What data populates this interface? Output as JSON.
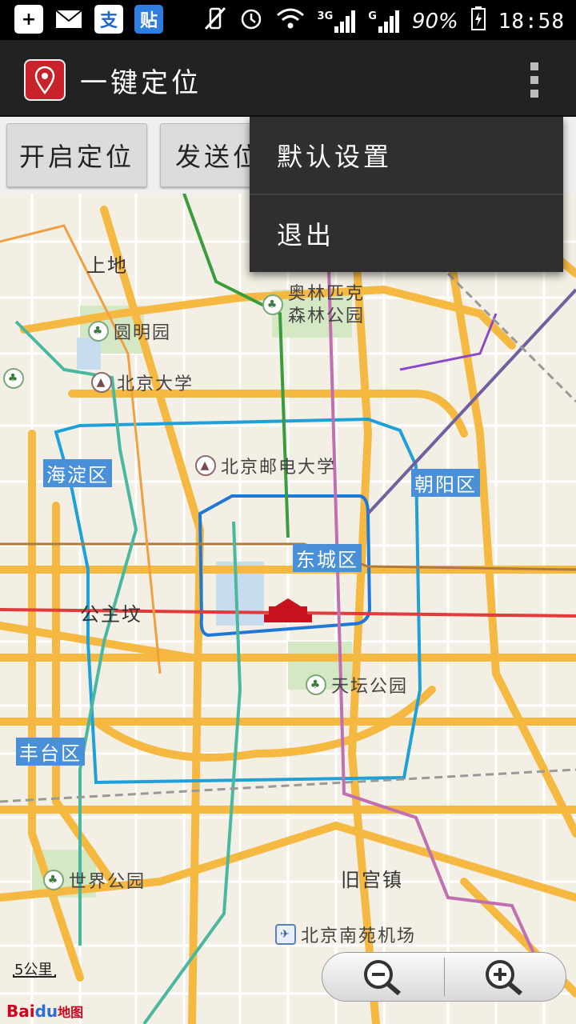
{
  "status_bar": {
    "battery": "90%",
    "time": "18:58",
    "net_3g": "3G",
    "net_g": "G",
    "notif_alipay": "支",
    "notif_tieba": "贴"
  },
  "app": {
    "title": "一键定位",
    "icon": "location-pin-icon"
  },
  "buttons": {
    "start_location": "开启定位",
    "send_location": "发送位置"
  },
  "overflow_menu": {
    "items": [
      "默认设置",
      "退出"
    ]
  },
  "map": {
    "labels": {
      "shangdi": "上地",
      "gongzhufen": "公主坟",
      "jiugongzhen": "旧宫镇"
    },
    "districts": [
      "海淀区",
      "朝阳区",
      "东城区",
      "丰台区"
    ],
    "pois": {
      "olympic": [
        "奥林匹克",
        "森林公园"
      ],
      "yuanmingyuan": "圆明园",
      "pku": "北京大学",
      "bupt": "北京邮电大学",
      "tiantan": "天坛公园",
      "shijie": "世界公园",
      "nanyuan_airport": "北京南苑机场"
    },
    "scale": "5公里",
    "logo_text": "Bai",
    "logo_du": "du",
    "logo_map": "地图"
  },
  "colors": {
    "action_bar": "#222222",
    "menu_bg": "#2f2f2f",
    "district_label": "#4a90d9",
    "road": "#f5b942",
    "ring": "#1ea0d8"
  }
}
